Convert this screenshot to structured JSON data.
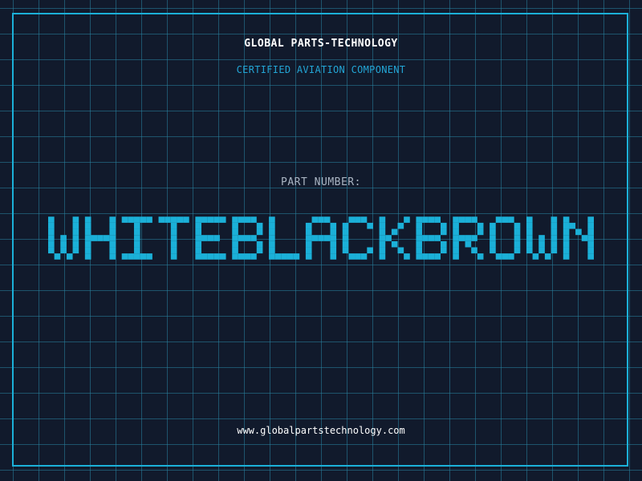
{
  "header": {
    "company": "GLOBAL PARTS-TECHNOLOGY",
    "tagline": "CERTIFIED AVIATION COMPONENT"
  },
  "part": {
    "label": "PART NUMBER:",
    "number": "WHITEBLACKBROWN"
  },
  "footer": {
    "url": "www.globalpartstechnology.com"
  },
  "colors": {
    "background": "#111a2c",
    "grid": "#2882a0",
    "accent": "#1bb0d8",
    "text": "#ffffff",
    "muted": "#a9b4c2"
  }
}
